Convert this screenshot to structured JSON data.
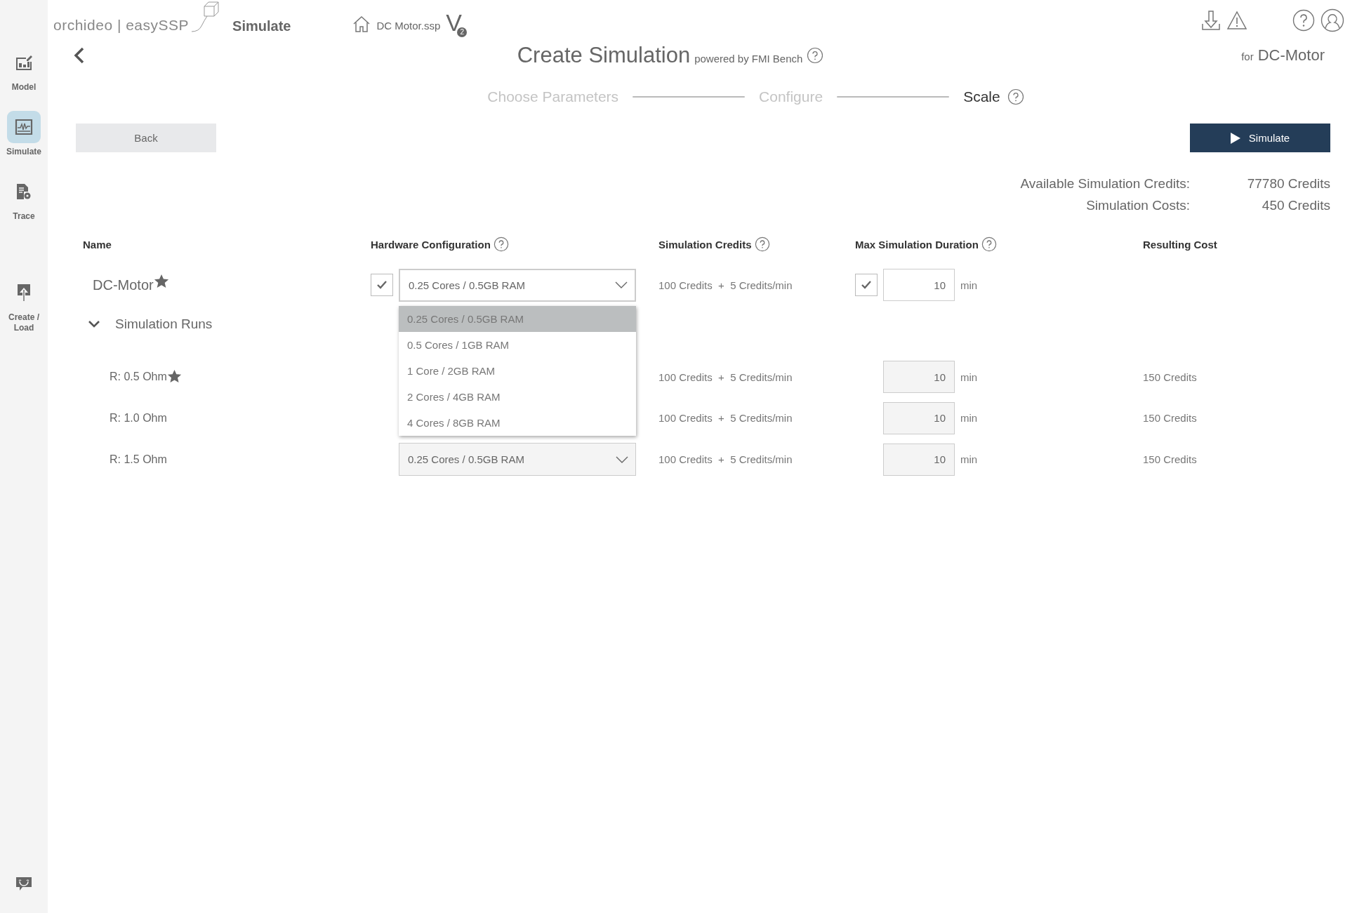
{
  "sidebar": {
    "items": [
      {
        "label": "Model",
        "selected": false
      },
      {
        "label": "Simulate",
        "selected": true
      },
      {
        "label": "Trace",
        "selected": false
      },
      {
        "label": "Create / Load",
        "selected": false
      }
    ]
  },
  "header": {
    "logo": "orchideo | easySSP",
    "app_title": "Simulate",
    "file_name": "DC Motor.ssp",
    "version_letter": "V",
    "version_number": "2"
  },
  "page": {
    "title": "Create Simulation",
    "subtitle": "powered by FMI Bench",
    "for_label": "for",
    "for_name": "DC-Motor"
  },
  "steps": [
    {
      "label": "Choose Parameters",
      "selected": false,
      "help": false
    },
    {
      "label": "Configure",
      "selected": false,
      "help": false
    },
    {
      "label": "Scale",
      "selected": true,
      "help": true
    }
  ],
  "buttons": {
    "back": "Back",
    "simulate": "Simulate"
  },
  "summary": [
    {
      "label": "Available Simulation Credits:",
      "value": "77780 Credits"
    },
    {
      "label": "Simulation Costs:",
      "value": "450 Credits"
    }
  ],
  "table": {
    "columns": [
      {
        "label": "Name",
        "help": false
      },
      {
        "label": "Hardware Configuration",
        "help": true
      },
      {
        "label": "Simulation Credits",
        "help": true
      },
      {
        "label": "Max Simulation Duration",
        "help": true
      },
      {
        "label": "Resulting Cost",
        "help": false
      }
    ],
    "model": {
      "name": "DC-Motor",
      "starred": true,
      "hardware_checked": true,
      "hardware": "0.25 Cores / 0.5GB RAM",
      "credits": "100 Credits  +  5 Credits/min",
      "duration_checked": true,
      "duration": "10",
      "unit": "min"
    },
    "group": {
      "label": "Simulation Runs",
      "expanded": true
    },
    "runs": [
      {
        "name": "R: 0.5 Ohm",
        "starred": true,
        "credits": "100 Credits  +  5 Credits/min",
        "duration": "10",
        "unit": "min",
        "cost": "150 Credits"
      },
      {
        "name": "R: 1.0 Ohm",
        "starred": false,
        "credits": "100 Credits  +  5 Credits/min",
        "duration": "10",
        "unit": "min",
        "cost": "150 Credits"
      },
      {
        "name": "R: 1.5 Ohm",
        "starred": false,
        "hardware": "0.25 Cores / 0.5GB RAM",
        "credits": "100 Credits  +  5 Credits/min",
        "duration": "10",
        "unit": "min",
        "cost": "150 Credits"
      }
    ],
    "dropdown": {
      "options": [
        {
          "label": "0.25 Cores / 0.5GB RAM",
          "selected": true
        },
        {
          "label": "0.5 Cores / 1GB RAM",
          "selected": false
        },
        {
          "label": "1 Core / 2GB RAM",
          "selected": false
        },
        {
          "label": "2 Cores / 4GB RAM",
          "selected": false
        },
        {
          "label": "4 Cores / 8GB RAM",
          "selected": false
        }
      ]
    }
  }
}
